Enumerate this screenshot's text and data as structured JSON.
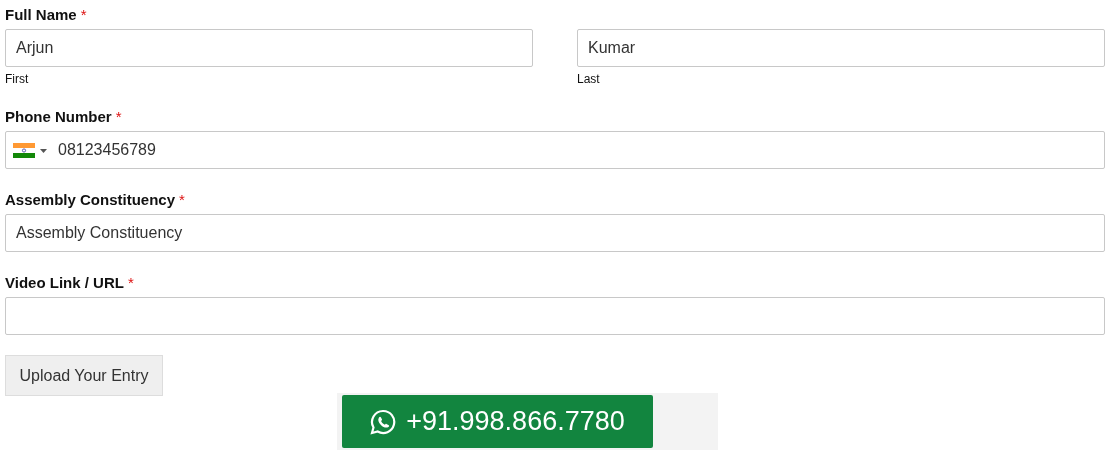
{
  "fields": [
    {
      "kind": "name",
      "label": "Full Name",
      "required_mark": "*",
      "parts": [
        {
          "value": "Arjun",
          "sublabel": "First"
        },
        {
          "value": "Kumar",
          "sublabel": "Last"
        }
      ]
    },
    {
      "kind": "phone",
      "label": "Phone Number",
      "required_mark": "*",
      "value": "08123456789"
    },
    {
      "kind": "text",
      "label": "Assembly Constituency",
      "required_mark": "*",
      "value": "Assembly Constituency"
    },
    {
      "kind": "text",
      "label": "Video Link / URL",
      "required_mark": "*"
    }
  ],
  "submit": "Upload Your Entry",
  "whatsapp": {
    "number": "+91.998.866.7780"
  }
}
